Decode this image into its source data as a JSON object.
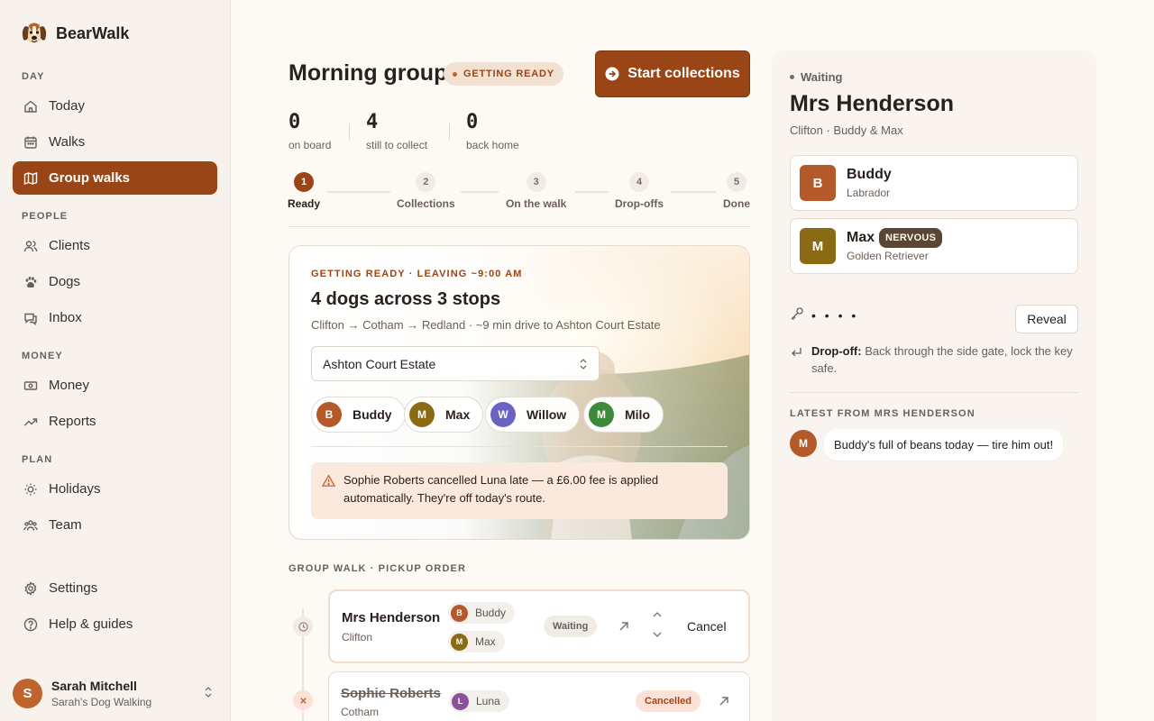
{
  "brand": {
    "name": "BearWalk"
  },
  "sidebar": {
    "sections": [
      {
        "title": "DAY",
        "items": [
          {
            "label": "Today",
            "icon": "home-icon"
          },
          {
            "label": "Walks",
            "icon": "calendar-icon"
          },
          {
            "label": "Group walks",
            "icon": "map-icon",
            "active": true
          }
        ]
      },
      {
        "title": "PEOPLE",
        "items": [
          {
            "label": "Clients",
            "icon": "users-icon"
          },
          {
            "label": "Dogs",
            "icon": "paw-icon"
          },
          {
            "label": "Inbox",
            "icon": "chat-icon"
          }
        ]
      },
      {
        "title": "MONEY",
        "items": [
          {
            "label": "Money",
            "icon": "banknote-icon"
          },
          {
            "label": "Reports",
            "icon": "trending-up-icon"
          }
        ]
      },
      {
        "title": "PLAN",
        "items": [
          {
            "label": "Holidays",
            "icon": "sun-icon"
          },
          {
            "label": "Team",
            "icon": "team-icon"
          }
        ]
      }
    ],
    "footer_items": [
      {
        "label": "Settings",
        "icon": "gear-icon"
      },
      {
        "label": "Help & guides",
        "icon": "help-icon"
      }
    ],
    "user": {
      "initial": "S",
      "name": "Sarah Mitchell",
      "business": "Sarah's Dog Walking"
    }
  },
  "header": {
    "title": "Morning group",
    "status": "GETTING READY",
    "primary_action": "Start collections"
  },
  "stats": [
    {
      "value": "0",
      "label": "on board"
    },
    {
      "value": "4",
      "label": "still to collect"
    },
    {
      "value": "0",
      "label": "back home"
    }
  ],
  "steps": [
    {
      "num": "1",
      "label": "Ready",
      "active": true
    },
    {
      "num": "2",
      "label": "Collections"
    },
    {
      "num": "3",
      "label": "On the walk"
    },
    {
      "num": "4",
      "label": "Drop-offs"
    },
    {
      "num": "5",
      "label": "Done"
    }
  ],
  "hero": {
    "kicker": "GETTING READY · LEAVING ~9:00 AM",
    "headline": "4 dogs across 3 stops",
    "route": "Clifton → Cotham → Redland · ~9 min drive to Ashton Court Estate",
    "location": "Ashton Court Estate",
    "dogs": [
      {
        "initial": "B",
        "name": "Buddy",
        "color": "#b45a2a"
      },
      {
        "initial": "M",
        "name": "Max",
        "color": "#8a6a12"
      },
      {
        "initial": "W",
        "name": "Willow",
        "color": "#6b63c4"
      },
      {
        "initial": "M",
        "name": "Milo",
        "color": "#3d8a3a"
      }
    ],
    "alert": "Sophie Roberts cancelled Luna late — a £6.00 fee is applied automatically. They're off today's route."
  },
  "pickup": {
    "heading": "GROUP WALK · PICKUP ORDER",
    "stops": [
      {
        "name": "Mrs Henderson",
        "area": "Clifton",
        "dogs": [
          {
            "initial": "B",
            "name": "Buddy",
            "color": "#b45a2a"
          },
          {
            "initial": "M",
            "name": "Max",
            "color": "#8a6a12"
          }
        ],
        "status": "Waiting",
        "cancel_label": "Cancel"
      },
      {
        "name": "Sophie Roberts",
        "area": "Cotham",
        "dogs": [
          {
            "initial": "L",
            "name": "Luna",
            "color": "#8c4f9e"
          }
        ],
        "status": "Cancelled"
      }
    ]
  },
  "detail": {
    "status": "Waiting",
    "name": "Mrs Henderson",
    "subtitle": "Clifton · Buddy & Max",
    "dogs": [
      {
        "initial": "B",
        "name": "Buddy",
        "breed": "Labrador",
        "color": "#b45a2a"
      },
      {
        "initial": "M",
        "name": "Max",
        "breed": "Golden Retriever",
        "color": "#8a6a12",
        "tag": "NERVOUS"
      }
    ],
    "key_code_masked": "• • • •",
    "reveal_label": "Reveal",
    "dropoff_label": "Drop-off:",
    "dropoff_text": "Back through the side gate, lock the key safe.",
    "latest_heading": "LATEST FROM MRS HENDERSON",
    "message": {
      "initial": "M",
      "text": "Buddy's full of beans today — tire him out!"
    }
  },
  "colors": {
    "accent": "#9a4516",
    "accent_soft": "#f3e2d3",
    "alert_bg": "#fbe9de",
    "bg": "#fdfaf6",
    "sidebar_bg": "#f7f2ec"
  }
}
